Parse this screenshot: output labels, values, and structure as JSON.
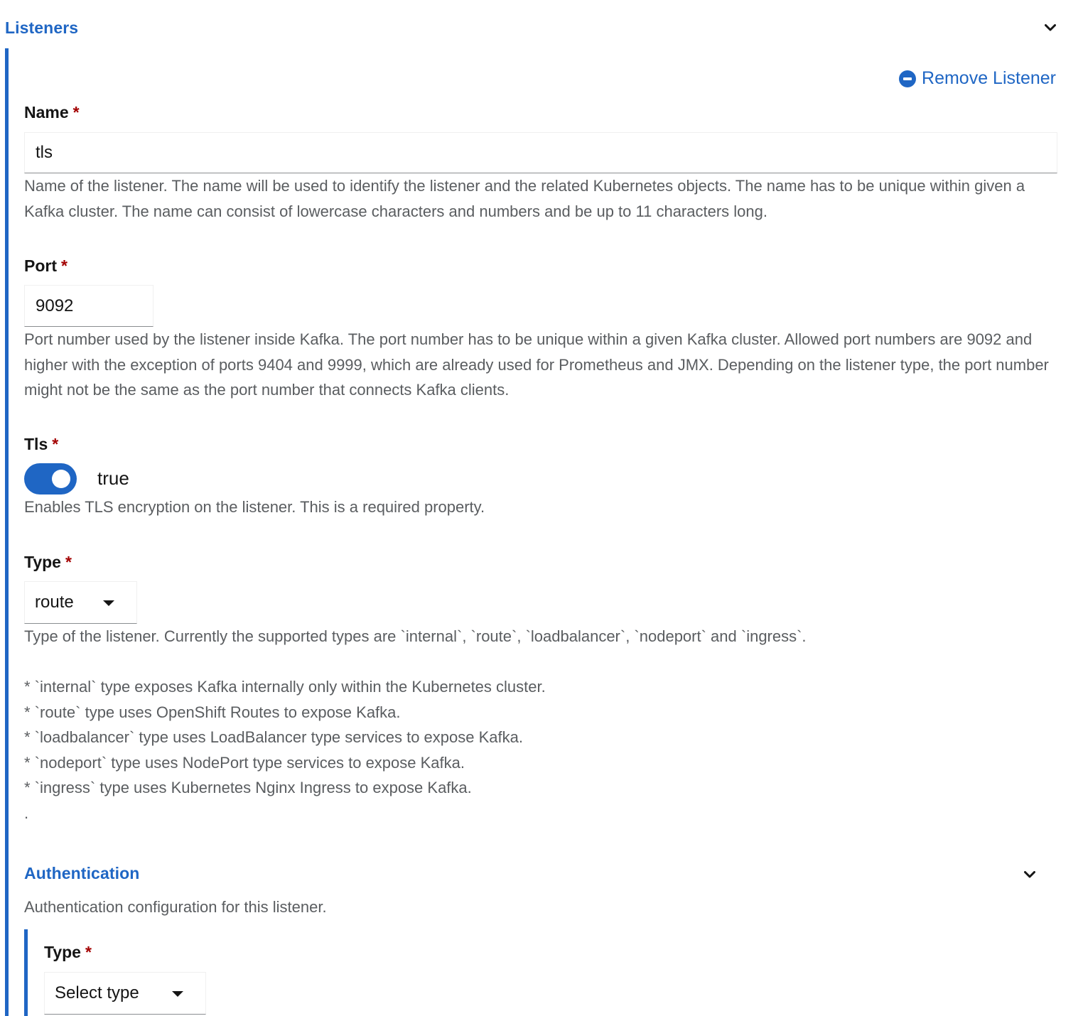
{
  "listeners": {
    "title": "Listeners",
    "remove_label": "Remove Listener",
    "colors": {
      "accent": "#1f66c4",
      "required": "#a30000",
      "help_text": "#5a5d60"
    }
  },
  "name_field": {
    "label": "Name",
    "required_mark": "*",
    "value": "tls",
    "help": "Name of the listener. The name will be used to identify the listener and the related Kubernetes objects. The name has to be unique within given a Kafka cluster. The name can consist of lowercase characters and numbers and be up to 11 characters long."
  },
  "port_field": {
    "label": "Port",
    "required_mark": "*",
    "value": "9092",
    "help": "Port number used by the listener inside Kafka. The port number has to be unique within a given Kafka cluster. Allowed port numbers are 9092 and higher with the exception of ports 9404 and 9999, which are already used for Prometheus and JMX. Depending on the listener type, the port number might not be the same as the port number that connects Kafka clients."
  },
  "tls_field": {
    "label": "Tls",
    "required_mark": "*",
    "toggle_text": "true",
    "checked": true,
    "help": "Enables TLS encryption on the listener. This is a required property."
  },
  "type_field": {
    "label": "Type",
    "required_mark": "*",
    "selected": "route",
    "help": "Type of the listener. Currently the supported types are `internal`, `route`, `loadbalancer`, `nodeport` and `ingress`.",
    "bullets": [
      "* `internal` type exposes Kafka internally only within the Kubernetes cluster.",
      "* `route` type uses OpenShift Routes to expose Kafka.",
      "* `loadbalancer` type uses LoadBalancer type services to expose Kafka.",
      "* `nodeport` type uses NodePort type services to expose Kafka.",
      "* `ingress` type uses Kubernetes Nginx Ingress to expose Kafka.",
      "."
    ]
  },
  "authentication": {
    "title": "Authentication",
    "help": "Authentication configuration for this listener.",
    "type_label": "Type",
    "required_mark": "*",
    "type_placeholder": "Select type"
  }
}
